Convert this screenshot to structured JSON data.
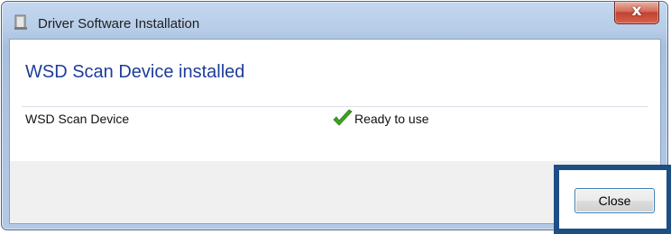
{
  "window": {
    "title": "Driver Software Installation",
    "close_glyph": "x"
  },
  "main": {
    "heading": "WSD Scan Device installed",
    "device": {
      "name": "WSD Scan Device",
      "status": "Ready to use",
      "status_icon": "green-checkmark-icon"
    }
  },
  "footer": {
    "close_label": "Close"
  },
  "colors": {
    "heading": "#1e3d9a",
    "highlight": "#1d4e84",
    "check": "#3fa31f"
  }
}
